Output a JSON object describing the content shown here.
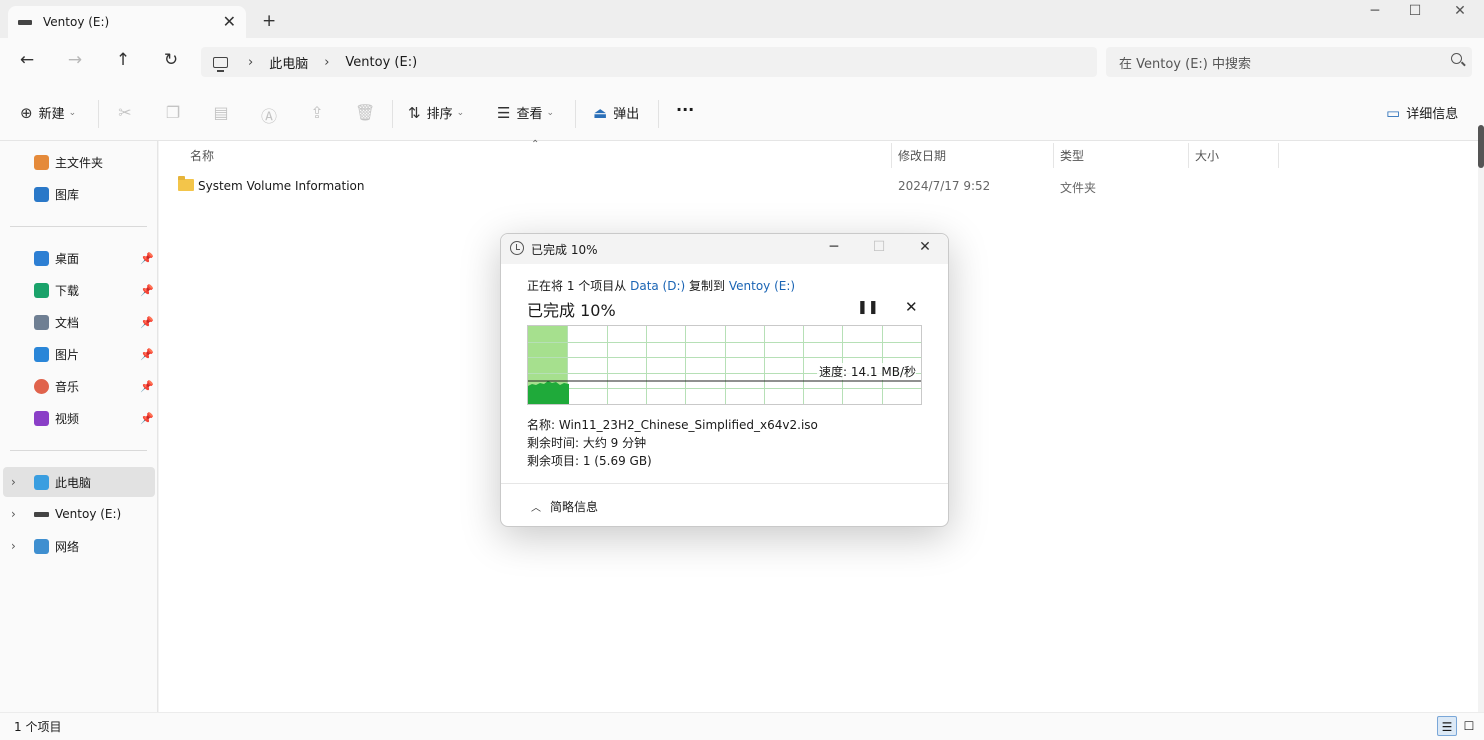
{
  "window": {
    "tab_title": "Ventoy (E:)",
    "tab_close": "✕",
    "new_tab": "+",
    "minimize": "─",
    "maximize": "☐",
    "close": "✕"
  },
  "address": {
    "separator": "›",
    "crumbs": [
      "此电脑",
      "Ventoy (E:)"
    ],
    "search_placeholder": "在 Ventoy (E:) 中搜索"
  },
  "toolbar": {
    "new_label": "新建",
    "sort_label": "排序",
    "view_label": "查看",
    "eject_label": "弹出",
    "more_label": "···",
    "details_label": "详细信息"
  },
  "sidebar": {
    "home": "主文件夹",
    "gallery": "图库",
    "quick_access": [
      {
        "label": "桌面",
        "icon": "desktop-icon",
        "color": "#2d7fd3"
      },
      {
        "label": "下载",
        "icon": "download-icon",
        "color": "#1aa26a"
      },
      {
        "label": "文档",
        "icon": "document-icon",
        "color": "#6f7f93"
      },
      {
        "label": "图片",
        "icon": "pictures-icon",
        "color": "#2a86d8"
      },
      {
        "label": "音乐",
        "icon": "music-icon",
        "color": "#e0634c"
      },
      {
        "label": "视频",
        "icon": "videos-icon",
        "color": "#8a3fc7"
      }
    ],
    "this_pc": "此电脑",
    "ventoy": "Ventoy (E:)",
    "network": "网络"
  },
  "columns": {
    "name": "名称",
    "modified": "修改日期",
    "type": "类型",
    "size": "大小"
  },
  "files": [
    {
      "name": "System Volume Information",
      "modified": "2024/7/17 9:52",
      "type": "文件夹",
      "size": ""
    }
  ],
  "status": {
    "item_count": "1 个项目"
  },
  "copy_dialog": {
    "title": "已完成 10%",
    "desc_prefix": "正在将 1 个项目从 ",
    "source": "Data (D:)",
    "desc_middle": " 复制到 ",
    "destination": "Ventoy (E:)",
    "percent_label": "已完成 10%",
    "progress_fraction": 0.1,
    "speed": "速度: 14.1 MB/秒",
    "name_line": "名称: Win11_23H2_Chinese_Simplified_x64v2.iso",
    "time_line": "剩余时间: 大约 9 分钟",
    "items_line": "剩余项目: 1 (5.69 GB)",
    "less_details": "简略信息",
    "accent_fill": "#a6e08e",
    "graph_fill": "#1faa3a"
  }
}
